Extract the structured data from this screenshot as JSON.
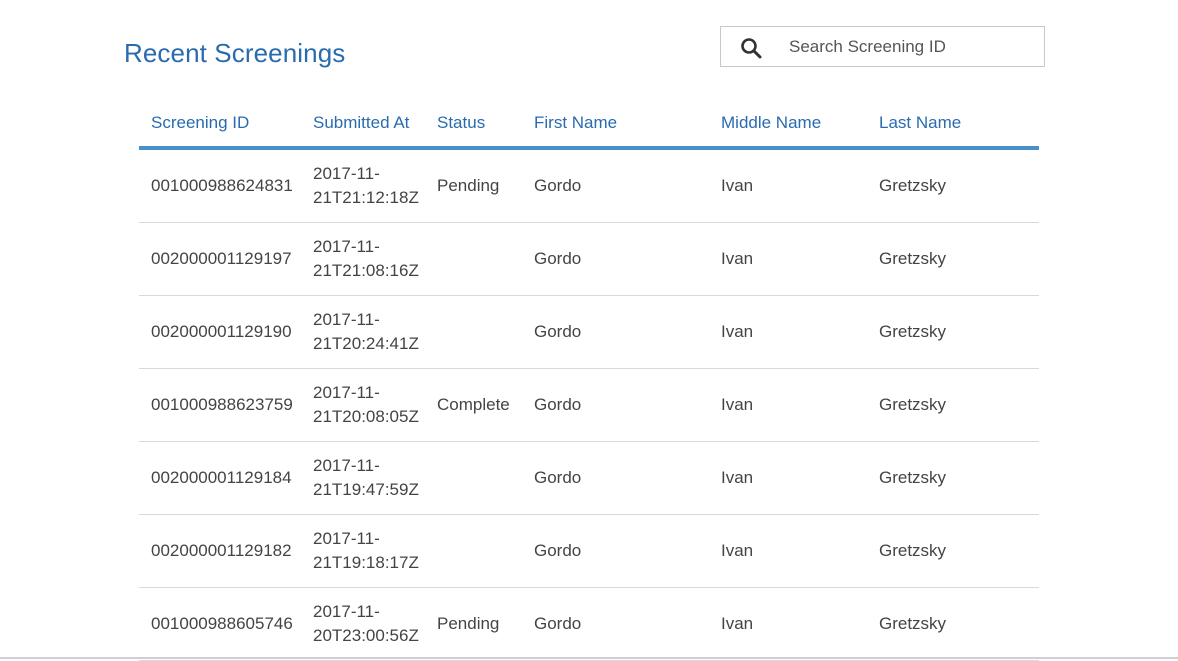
{
  "page": {
    "title": "Recent Screenings"
  },
  "search": {
    "placeholder": "Search Screening ID",
    "value": ""
  },
  "table": {
    "columns": [
      "Screening ID",
      "Submitted At",
      "Status",
      "First Name",
      "Middle Name",
      "Last Name"
    ],
    "rows": [
      {
        "id": "001000988624831",
        "submitted_date": "2017-11-",
        "submitted_time": "21T21:12:18Z",
        "status": "Pending",
        "first": "Gordo",
        "middle": "Ivan",
        "last": "Gretzsky"
      },
      {
        "id": "002000001129197",
        "submitted_date": "2017-11-",
        "submitted_time": "21T21:08:16Z",
        "status": "",
        "first": "Gordo",
        "middle": "Ivan",
        "last": "Gretzsky"
      },
      {
        "id": "002000001129190",
        "submitted_date": "2017-11-",
        "submitted_time": "21T20:24:41Z",
        "status": "",
        "first": "Gordo",
        "middle": "Ivan",
        "last": "Gretzsky"
      },
      {
        "id": "001000988623759",
        "submitted_date": "2017-11-",
        "submitted_time": "21T20:08:05Z",
        "status": "Complete",
        "first": "Gordo",
        "middle": "Ivan",
        "last": "Gretzsky"
      },
      {
        "id": "002000001129184",
        "submitted_date": "2017-11-",
        "submitted_time": "21T19:47:59Z",
        "status": "",
        "first": "Gordo",
        "middle": "Ivan",
        "last": "Gretzsky"
      },
      {
        "id": "002000001129182",
        "submitted_date": "2017-11-",
        "submitted_time": "21T19:18:17Z",
        "status": "",
        "first": "Gordo",
        "middle": "Ivan",
        "last": "Gretzsky"
      },
      {
        "id": "001000988605746",
        "submitted_date": "2017-11-",
        "submitted_time": "20T23:00:56Z",
        "status": "Pending",
        "first": "Gordo",
        "middle": "Ivan",
        "last": "Gretzsky"
      }
    ]
  },
  "colors": {
    "accent": "#2a6bb0",
    "header_rule": "#4a8fc6",
    "row_divider": "#d9d9d9",
    "text": "#444444"
  },
  "icons": {
    "search": "search-icon"
  }
}
